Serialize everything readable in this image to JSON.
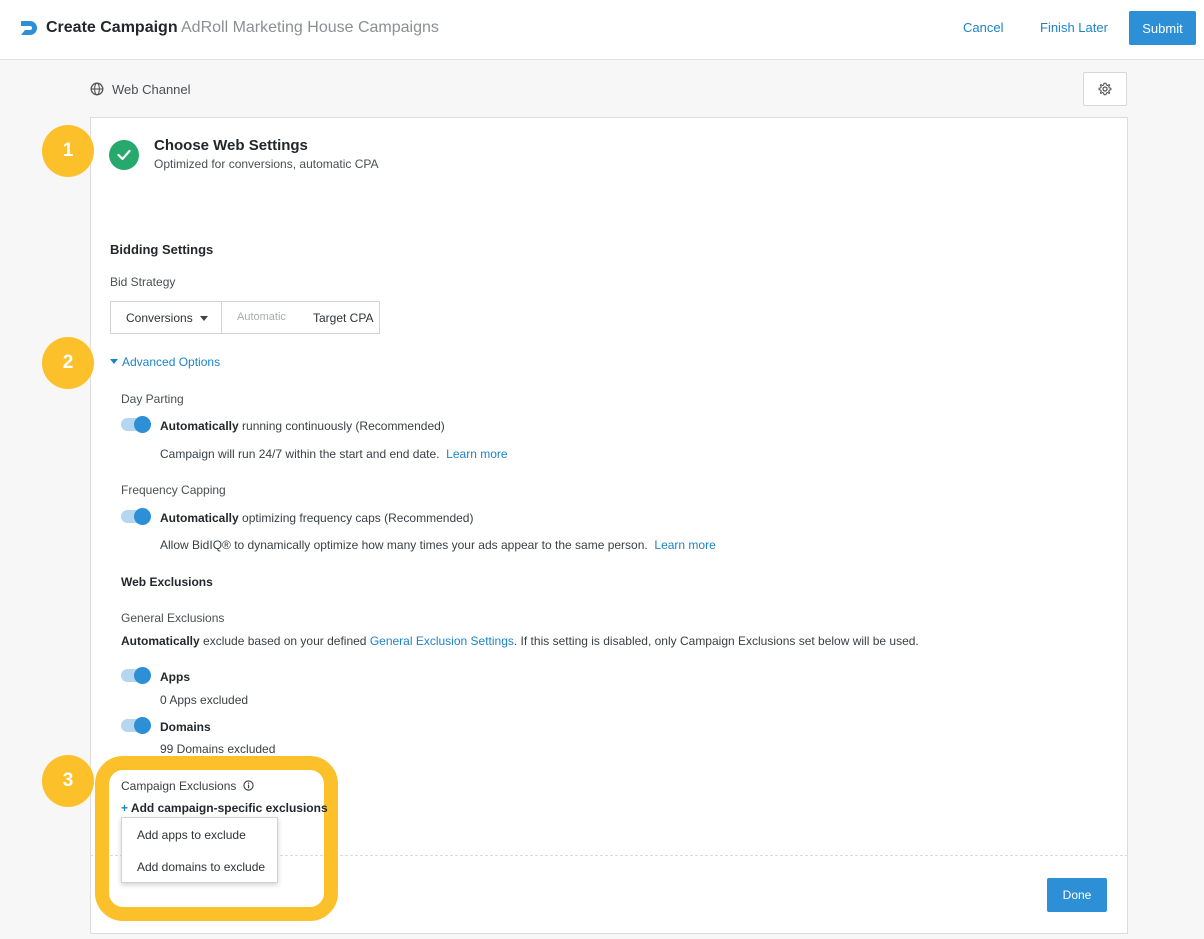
{
  "header": {
    "title": "Create Campaign",
    "subtitle": "AdRoll Marketing House Campaigns",
    "cancel_label": "Cancel",
    "finish_later_label": "Finish Later",
    "submit_label": "Submit"
  },
  "channel": {
    "label": "Web Channel"
  },
  "steps": [
    "1",
    "2",
    "3"
  ],
  "web_settings": {
    "title": "Choose Web Settings",
    "subtitle": "Optimized for conversions, automatic CPA"
  },
  "bidding": {
    "heading": "Bidding Settings",
    "strategy_label": "Bid Strategy",
    "strategy_value": "Conversions",
    "automatic_label": "Automatic",
    "target_label": "Target CPA"
  },
  "advanced": {
    "toggle_label": "Advanced Options",
    "day_parting": {
      "label": "Day Parting",
      "bold": "Automatically",
      "text": " running continuously (Recommended)",
      "desc": "Campaign will run 24/7 within the start and end date.",
      "learn_more": "Learn more",
      "enabled": true
    },
    "frequency_capping": {
      "label": "Frequency Capping",
      "bold": "Automatically",
      "text": " optimizing frequency caps (Recommended)",
      "desc": "Allow BidIQ® to dynamically optimize how many times your ads appear to the same person.",
      "learn_more": "Learn more",
      "enabled": true
    }
  },
  "exclusions": {
    "heading": "Web Exclusions",
    "general_label": "General Exclusions",
    "general_bold": "Automatically",
    "general_text_1": " exclude based on your defined ",
    "general_link": "General Exclusion Settings",
    "general_text_2": ". If this setting is disabled, only Campaign Exclusions set below will be used.",
    "apps_label": "Apps",
    "apps_count": "0 Apps excluded",
    "apps_enabled": true,
    "domains_label": "Domains",
    "domains_count": "99 Domains excluded",
    "domains_enabled": true,
    "campaign_label": "Campaign Exclusions",
    "add_label": "Add campaign-specific exclusions",
    "add_prefix": "+",
    "menu": [
      "Add apps to exclude",
      "Add domains to exclude"
    ]
  },
  "footer": {
    "done_label": "Done"
  },
  "colors": {
    "accent": "#2d8fd5",
    "link": "#1d83c9",
    "success": "#27a96d",
    "highlight": "#fcc12a"
  },
  "icons": [
    "adroll-logo-icon",
    "globe-icon",
    "gear-icon",
    "check-icon",
    "caret-down-icon",
    "info-icon"
  ]
}
